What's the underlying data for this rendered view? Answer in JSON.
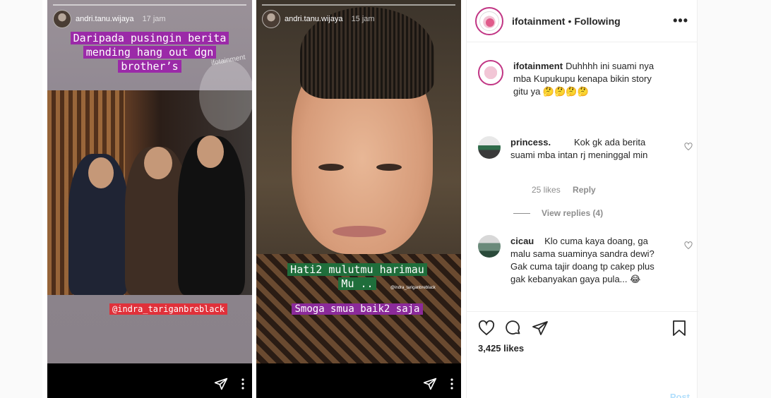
{
  "stories": [
    {
      "user": "andri.tanu.wijaya",
      "time": "17 jam",
      "caption_lines": [
        "Daripada pusingin berita",
        "mending hang out dgn",
        "brother’s"
      ],
      "tag": "@indra_tariganbreblack",
      "watermark": "ifotainment"
    },
    {
      "user": "andri.tanu.wijaya",
      "time": "15 jam",
      "caption_lines": [
        "Hati2 mulutmu harimau",
        "Mu .."
      ],
      "small_tag": "@indra_tariganbreblack",
      "caption2": "Smoga smua baik2 saja"
    }
  ],
  "post": {
    "account": "ifotainment",
    "separator": "•",
    "follow_status": "Following",
    "more": "•••"
  },
  "comments": [
    {
      "user": "ifotainment",
      "text": "Duhhhh ini suami nya mba Kupukupu kenapa bikin story gitu ya 🤔🤔🤔🤔"
    },
    {
      "user": "princess.",
      "text": "Kok gk ada berita suami mba intan rj meninggal min",
      "likes": "25 likes",
      "reply": "Reply",
      "view_replies": "View replies (4)"
    },
    {
      "user": "cicau",
      "text": "Klo cuma kaya doang, ga malu sama suaminya sandra dewi? Gak cuma tajir doang tp cakep plus gak kebanyakan gaya pula... 😂"
    }
  ],
  "likes_count": "3,425 likes",
  "post_button": "Post",
  "icons": {
    "like": "heart-icon",
    "comment": "comment-icon",
    "share": "send-icon",
    "save": "bookmark-icon"
  }
}
